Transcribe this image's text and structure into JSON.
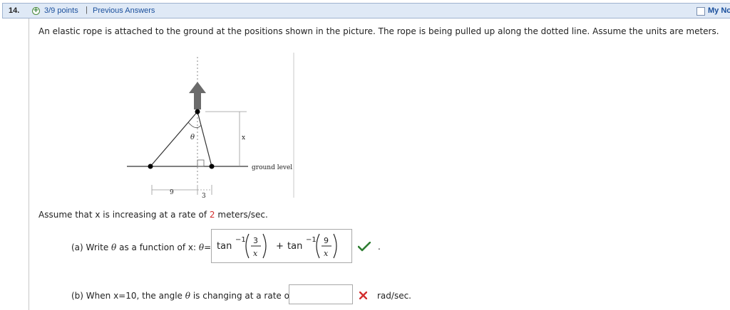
{
  "question": {
    "number": "14.",
    "points": "3/9 points",
    "separator": "|",
    "previous_answers": "Previous Answers",
    "my_notes": "My Notes",
    "prompt": "An elastic rope is attached to the ground at the positions shown in the picture. The rope is being pulled up along the dotted line. Assume the units are meters."
  },
  "figure": {
    "theta": "θ",
    "x": "x",
    "ground": "ground level",
    "nine": "9",
    "three": "3"
  },
  "rate": {
    "prefix": "Assume that x is increasing at a rate of",
    "value": "2",
    "suffix": "meters/sec."
  },
  "part_a": {
    "label_prefix": "(a) Write",
    "theta": "θ",
    "label_mid": "as a function of x:",
    "eq": "=",
    "answer": {
      "fn1": "tan",
      "exp1": "−1",
      "num1": "3",
      "den1": "x",
      "plus": "+",
      "fn2": "tan",
      "exp2": "−1",
      "num2": "9",
      "den2": "x"
    },
    "status": "correct",
    "dot": "."
  },
  "part_b": {
    "label_prefix": "(b) When x=10, the angle",
    "theta": "θ",
    "label_suffix": "is changing at a rate of",
    "value": "",
    "status": "incorrect",
    "units": "rad/sec."
  },
  "colors": {
    "header_bg": "#dfe9f6",
    "link": "#1a4f9c",
    "correct": "#2e7d32",
    "incorrect": "#d32f2f"
  }
}
